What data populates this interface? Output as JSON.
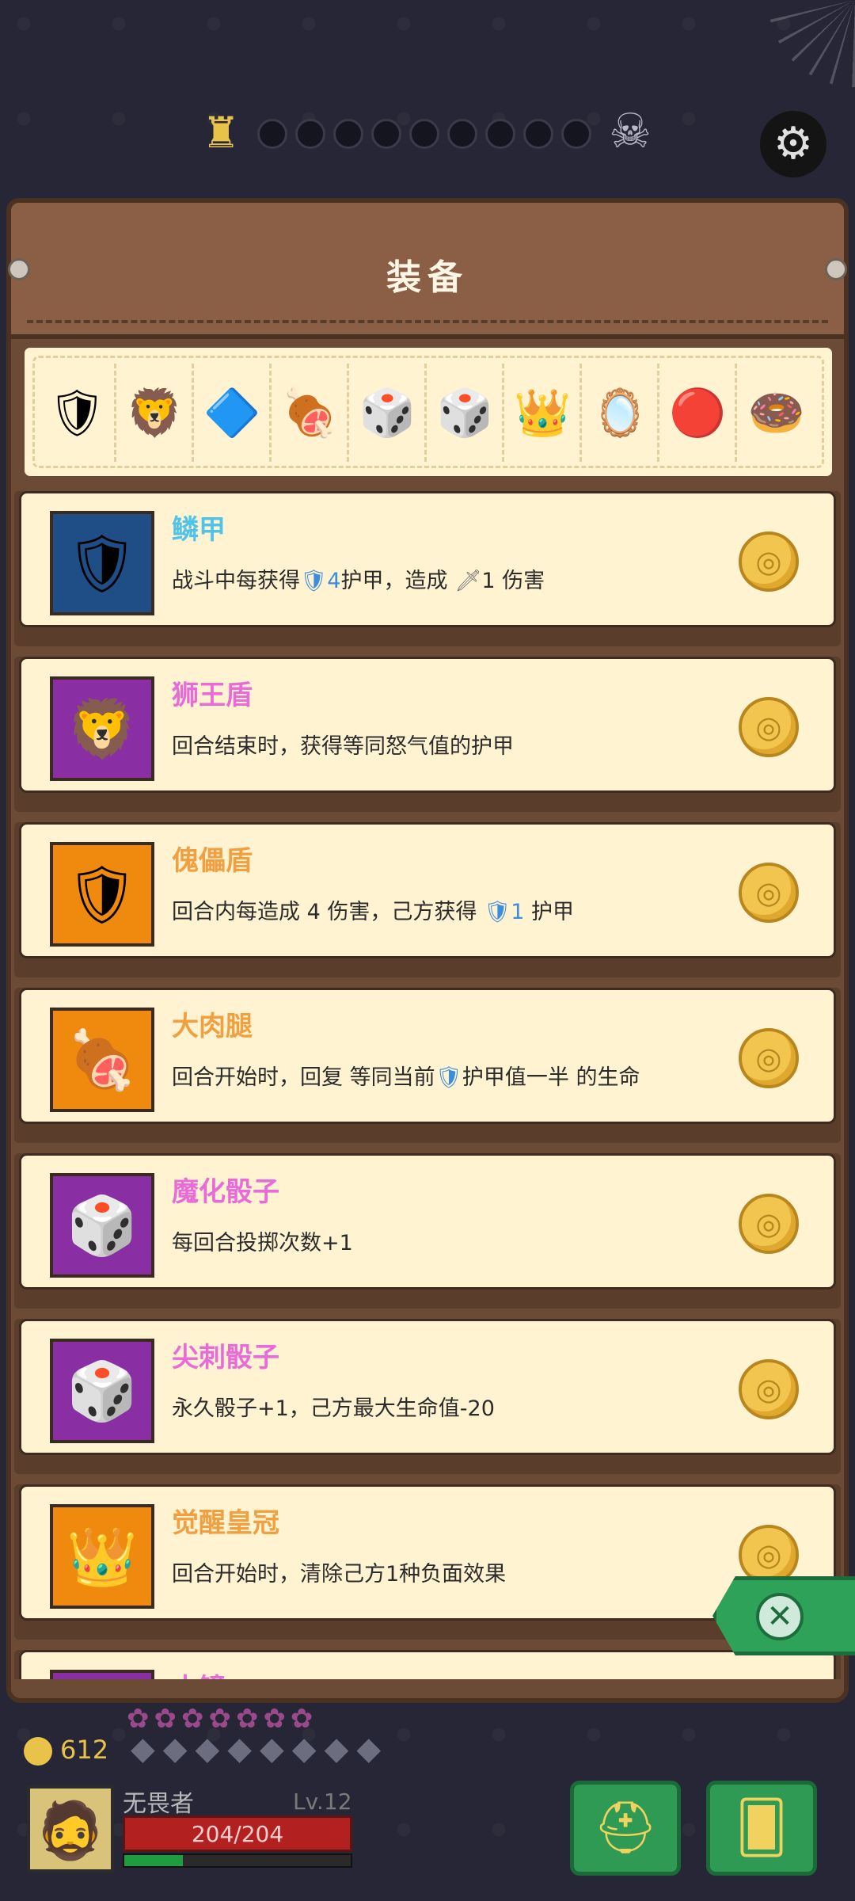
{
  "header": {
    "title": "装备"
  },
  "equip_strip": [
    "scale-armor-icon",
    "lion-shield-icon",
    "puppet-shield-icon",
    "meat-leg-icon",
    "demon-dice-icon",
    "spike-dice-icon",
    "crown-icon",
    "mirror-icon",
    "button-icon",
    "donut-icon"
  ],
  "items": [
    {
      "name": "鳞甲",
      "name_color": "#4fc3e8",
      "icon_bg": "#1f4e86",
      "icon": "🛡",
      "desc_parts": [
        "战斗中每获得",
        "🛡",
        "4",
        "护甲，造成 ",
        "🗡",
        "1 伤害"
      ]
    },
    {
      "name": "狮王盾",
      "name_color": "#e86bd8",
      "icon_bg": "#8a2fa3",
      "icon": "🦁",
      "desc_parts": [
        "回合结束时，获得等同怒气值的护甲"
      ]
    },
    {
      "name": "傀儡盾",
      "name_color": "#f0a040",
      "icon_bg": "#ef8a0f",
      "icon": "🛡",
      "desc_parts": [
        "回合内每造成 4 伤害，己方获得 ",
        "🛡",
        "1",
        " 护甲"
      ]
    },
    {
      "name": "大肉腿",
      "name_color": "#f0a040",
      "icon_bg": "#ef8a0f",
      "icon": "🍖",
      "desc_parts": [
        "回合开始时，回复 等同当前",
        "🛡",
        "护甲值一半 的生命"
      ]
    },
    {
      "name": "魔化骰子",
      "name_color": "#e86bd8",
      "icon_bg": "#8a2fa3",
      "icon": "🎲",
      "desc_parts": [
        "每回合投掷次数+1"
      ]
    },
    {
      "name": "尖刺骰子",
      "name_color": "#e86bd8",
      "icon_bg": "#8a2fa3",
      "icon": "🎲",
      "desc_parts": [
        "永久骰子+1，己方最大生命值-20"
      ]
    },
    {
      "name": "觉醒皇冠",
      "name_color": "#f0a040",
      "icon_bg": "#ef8a0f",
      "icon": "👑",
      "desc_parts": [
        "回合开始时，清除己方1种负面效果"
      ]
    },
    {
      "name": "古镜",
      "name_color": "#e86bd8",
      "icon_bg": "#8a2fa3",
      "icon": "🪞",
      "desc_parts": [
        ""
      ]
    }
  ],
  "player": {
    "gold": "612",
    "name": "无畏者",
    "level": "Lv.12",
    "hp": "204/204",
    "xp_fraction": 0.26
  },
  "colors": {
    "shield_blue": "#3b8de0"
  }
}
